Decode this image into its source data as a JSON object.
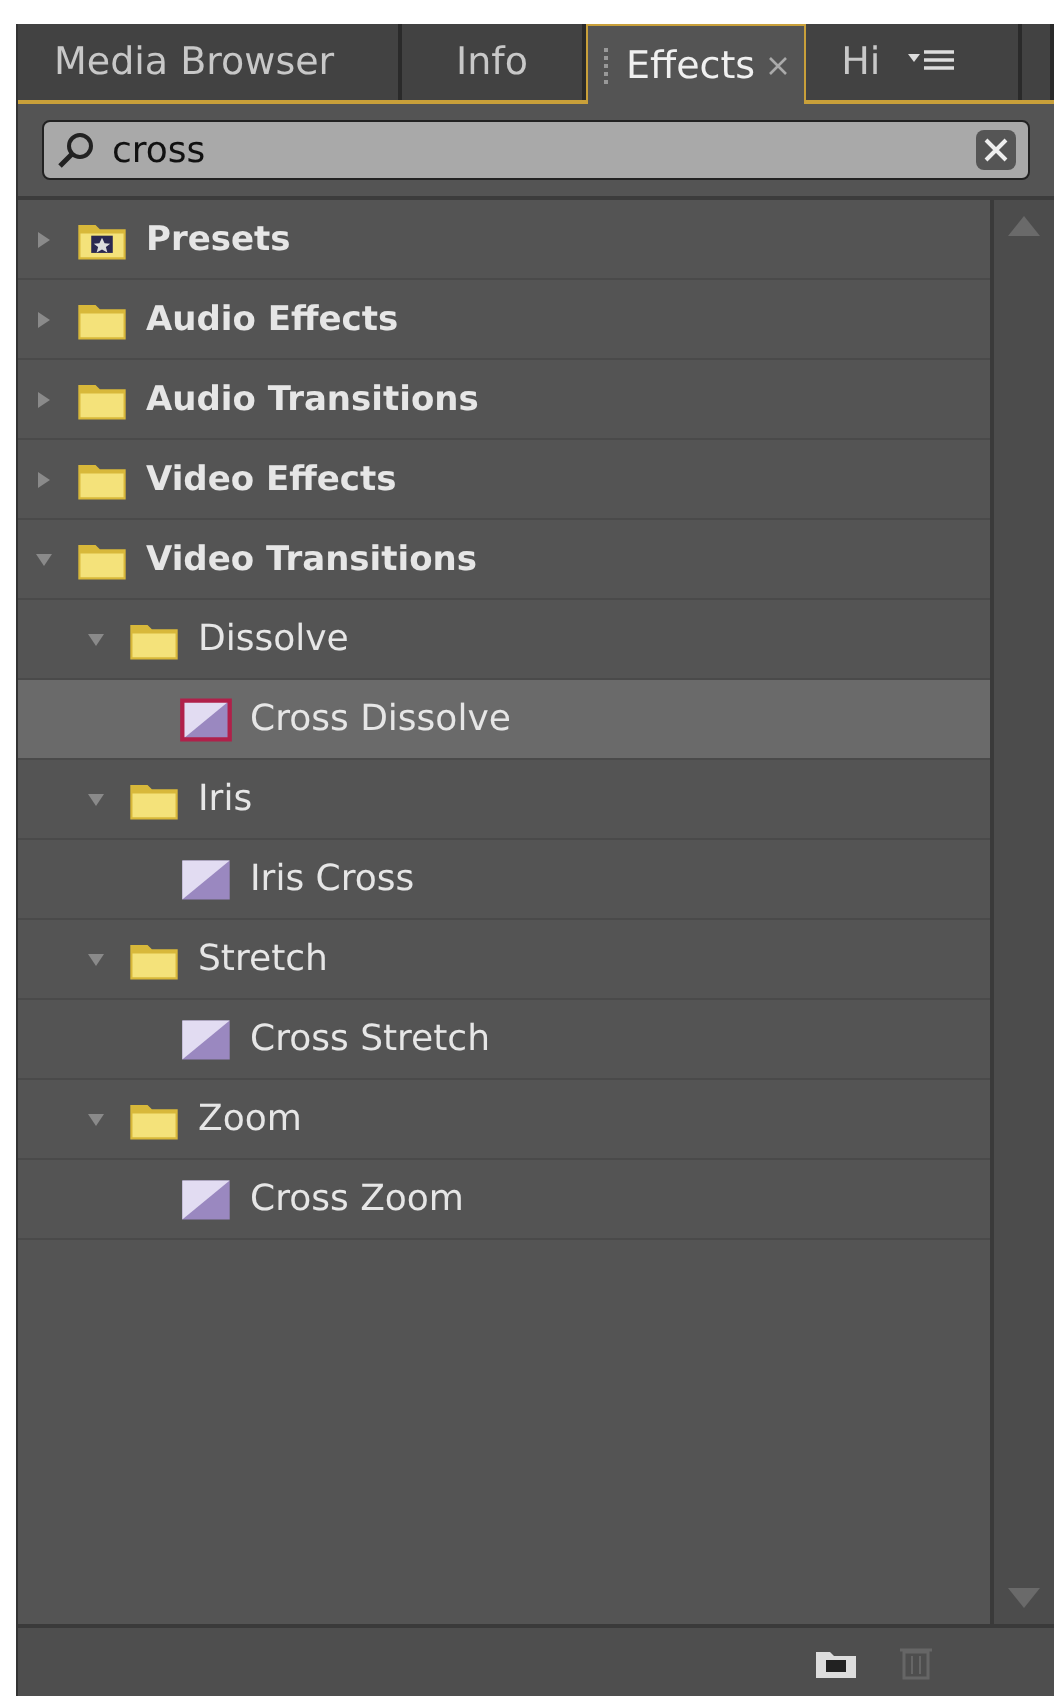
{
  "tabs": [
    {
      "label": "Media Browser",
      "selected": false,
      "closable": false
    },
    {
      "label": "Info",
      "selected": false,
      "closable": false
    },
    {
      "label": "Effects",
      "selected": true,
      "closable": true
    },
    {
      "label": "Hi",
      "selected": false,
      "closable": false
    }
  ],
  "search": {
    "value": "cross"
  },
  "tree": [
    {
      "label": "Presets",
      "kind": "presets",
      "expanded": false
    },
    {
      "label": "Audio Effects",
      "kind": "folder",
      "expanded": false
    },
    {
      "label": "Audio Transitions",
      "kind": "folder",
      "expanded": false
    },
    {
      "label": "Video Effects",
      "kind": "folder",
      "expanded": false
    },
    {
      "label": "Video Transitions",
      "kind": "folder",
      "expanded": true,
      "children": [
        {
          "label": "Dissolve",
          "kind": "folder",
          "expanded": true,
          "children": [
            {
              "label": "Cross Dissolve",
              "kind": "effect",
              "selected": true
            }
          ]
        },
        {
          "label": "Iris",
          "kind": "folder",
          "expanded": true,
          "children": [
            {
              "label": "Iris Cross",
              "kind": "effect",
              "selected": false
            }
          ]
        },
        {
          "label": "Stretch",
          "kind": "folder",
          "expanded": true,
          "children": [
            {
              "label": "Cross Stretch",
              "kind": "effect",
              "selected": false
            }
          ]
        },
        {
          "label": "Zoom",
          "kind": "folder",
          "expanded": true,
          "children": [
            {
              "label": "Cross Zoom",
              "kind": "effect",
              "selected": false
            }
          ]
        }
      ]
    }
  ]
}
